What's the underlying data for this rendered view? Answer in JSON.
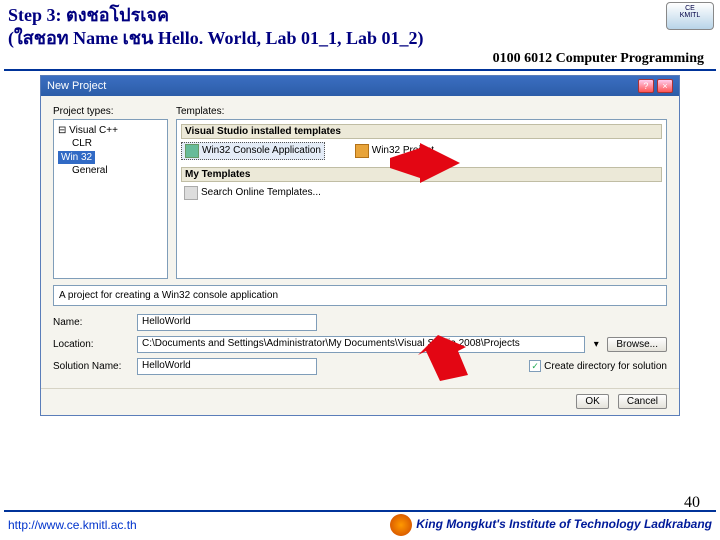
{
  "header": {
    "step_text": "Step 3: ตงชอโปรเจค",
    "sub_text": "(ใสชอท  Name เชน  Hello. World, Lab 01_1, Lab 01_2)",
    "course": "0100 6012 Computer Programming"
  },
  "dialog": {
    "title": "New Project",
    "labels": {
      "project_types": "Project types:",
      "templates": "Templates:"
    },
    "tree": {
      "root": "Visual C++",
      "clr": "CLR",
      "win32": "Win 32",
      "general": "General"
    },
    "templates": {
      "section1": "Visual Studio installed templates",
      "item1": "Win32 Console Application",
      "item2": "Win32 Project",
      "section2": "My Templates",
      "item3": "Search Online Templates..."
    },
    "description": "A project for creating a Win32 console application",
    "form": {
      "name_label": "Name:",
      "name_value": "HelloWorld",
      "location_label": "Location:",
      "location_value": "C:\\Documents and Settings\\Administrator\\My Documents\\Visual Studio 2008\\Projects",
      "browse": "Browse...",
      "solution_label": "Solution Name:",
      "solution_value": "HelloWorld",
      "checkbox": "Create directory for solution"
    },
    "buttons": {
      "ok": "OK",
      "cancel": "Cancel"
    }
  },
  "footer": {
    "url": "http://www.ce.kmitl.ac.th",
    "inst": "King Mongkut's Institute of Technology Ladkrabang",
    "page": "40"
  }
}
